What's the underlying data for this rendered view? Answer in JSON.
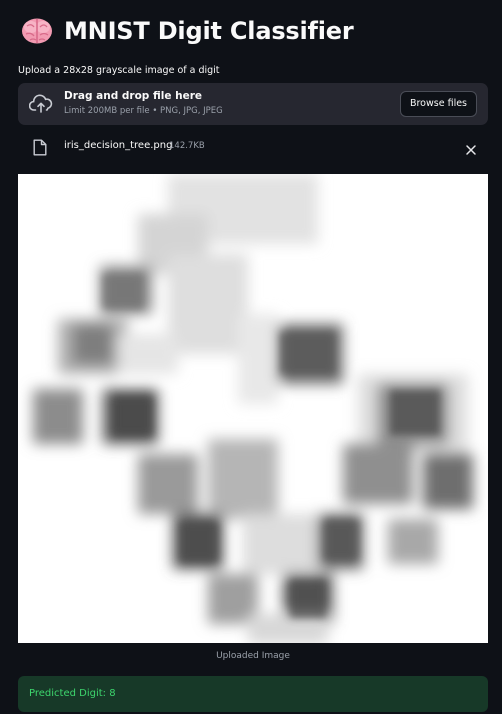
{
  "header": {
    "icon": "brain-icon",
    "title": "MNIST Digit Classifier"
  },
  "uploader": {
    "label": "Upload a 28x28 grayscale image of a digit",
    "dropzone_title": "Drag and drop file here",
    "dropzone_limits": "Limit 200MB per file • PNG, JPG, JPEG",
    "browse_label": "Browse files"
  },
  "file": {
    "name": "iris_decision_tree.png",
    "size": "142.7KB"
  },
  "image": {
    "caption": "Uploaded Image"
  },
  "result": {
    "text": "Predicted Digit: 8",
    "background": "#173928",
    "color": "#3dd56d"
  },
  "colors": {
    "page_background": "#0e1117",
    "panel_background": "#262730"
  }
}
